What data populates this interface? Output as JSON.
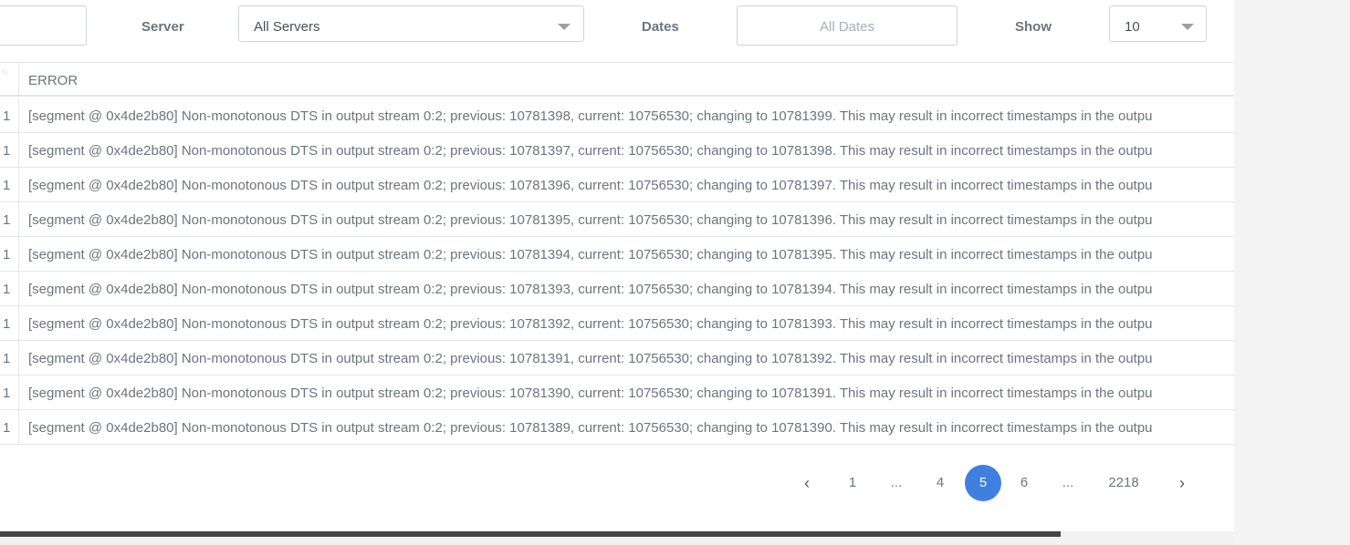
{
  "filters": {
    "server_label": "Server",
    "server_value": "All Servers",
    "dates_label": "Dates",
    "dates_placeholder": "All Dates",
    "show_label": "Show",
    "show_value": "10"
  },
  "table": {
    "partial_col_value": "1",
    "error_header": "ERROR",
    "rows": [
      "[segment @ 0x4de2b80] Non-monotonous DTS in output stream 0:2; previous: 10781398, current: 10756530; changing to 10781399. This may result in incorrect timestamps in the outpu",
      "[segment @ 0x4de2b80] Non-monotonous DTS in output stream 0:2; previous: 10781397, current: 10756530; changing to 10781398. This may result in incorrect timestamps in the outpu",
      "[segment @ 0x4de2b80] Non-monotonous DTS in output stream 0:2; previous: 10781396, current: 10756530; changing to 10781397. This may result in incorrect timestamps in the outpu",
      "[segment @ 0x4de2b80] Non-monotonous DTS in output stream 0:2; previous: 10781395, current: 10756530; changing to 10781396. This may result in incorrect timestamps in the outpu",
      "[segment @ 0x4de2b80] Non-monotonous DTS in output stream 0:2; previous: 10781394, current: 10756530; changing to 10781395. This may result in incorrect timestamps in the outpu",
      "[segment @ 0x4de2b80] Non-monotonous DTS in output stream 0:2; previous: 10781393, current: 10756530; changing to 10781394. This may result in incorrect timestamps in the outpu",
      "[segment @ 0x4de2b80] Non-monotonous DTS in output stream 0:2; previous: 10781392, current: 10756530; changing to 10781393. This may result in incorrect timestamps in the outpu",
      "[segment @ 0x4de2b80] Non-monotonous DTS in output stream 0:2; previous: 10781391, current: 10756530; changing to 10781392. This may result in incorrect timestamps in the outpu",
      "[segment @ 0x4de2b80] Non-monotonous DTS in output stream 0:2; previous: 10781390, current: 10756530; changing to 10781391. This may result in incorrect timestamps in the outpu",
      "[segment @ 0x4de2b80] Non-monotonous DTS in output stream 0:2; previous: 10781389, current: 10756530; changing to 10781390. This may result in incorrect timestamps in the outpu"
    ]
  },
  "pagination": {
    "prev": "‹",
    "p1": "1",
    "ellipsis1": "...",
    "p4": "4",
    "p5": "5",
    "p6": "6",
    "ellipsis2": "...",
    "last": "2218",
    "next": "›",
    "active_page": "5",
    "active_color": "#3f7fe0"
  }
}
